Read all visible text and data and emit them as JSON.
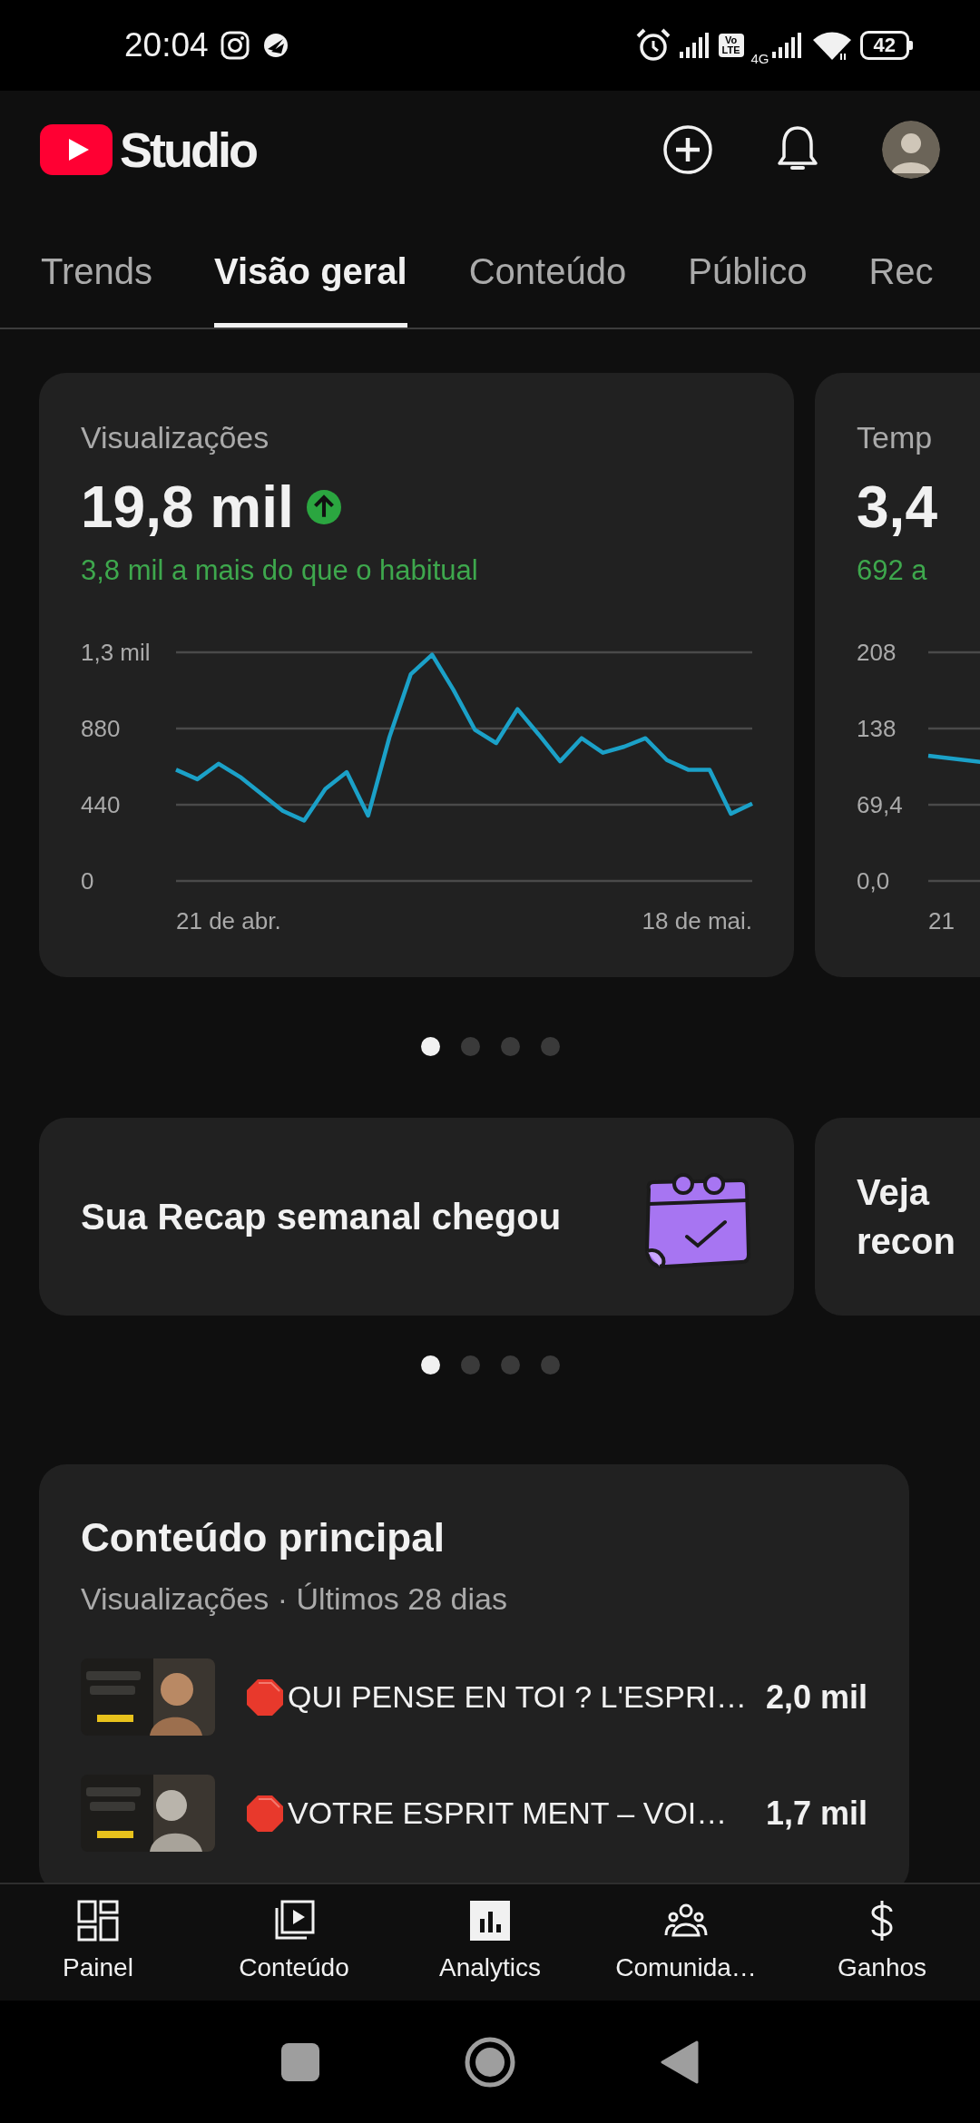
{
  "status_bar": {
    "time": "20:04",
    "volte": "Vo LTE",
    "network": "4G",
    "battery": "42"
  },
  "header": {
    "logo_text": "Studio"
  },
  "tabs": [
    {
      "label": "Trends",
      "selected": false
    },
    {
      "label": "Visão geral",
      "selected": true
    },
    {
      "label": "Conteúdo",
      "selected": false
    },
    {
      "label": "Público",
      "selected": false
    },
    {
      "label": "Rec",
      "selected": false
    }
  ],
  "metric_cards": [
    {
      "title": "Visualizações",
      "value": "19,8 mil",
      "trend_up": true,
      "comparison": "3,8 mil a mais do que o habitual",
      "chart_data": {
        "type": "line",
        "series": [
          {
            "color": "#1ba1c8",
            "values": [
              642,
              587,
              677,
              601,
              503,
              405,
              349,
              531,
              628,
              377,
              831,
              1194,
              1306,
              1103,
              873,
              796,
              992,
              845,
              691,
              824,
              740,
              775,
              824,
              698,
              642,
              642,
              388,
              447
            ]
          }
        ],
        "yticks": [
          880,
          440,
          0
        ],
        "ylim": [
          0,
          1320
        ]
      },
      "y_axis_top_label": "1,3 mil",
      "x_axis_labels": [
        "21 de abr.",
        "18 de mai."
      ]
    },
    {
      "title": "Temp",
      "value": "3,4",
      "comparison": "692 a",
      "y_axis_labels": [
        "208",
        "138",
        "69,4",
        "0,0"
      ],
      "x_label": "21"
    }
  ],
  "metric_dots": [
    {
      "selected": true
    },
    {
      "selected": false
    },
    {
      "selected": false
    },
    {
      "selected": false
    }
  ],
  "recap_cards": [
    {
      "lines": [
        "Sua Recap semanal chegou"
      ],
      "kind": "calendar"
    },
    {
      "lines": [
        "Veja",
        "recon"
      ]
    }
  ],
  "recap_dots": [
    {
      "selected": true
    },
    {
      "selected": false
    },
    {
      "selected": false
    },
    {
      "selected": false
    }
  ],
  "top_content": {
    "title": "Conteúdo principal",
    "subtitle": "Visualizações · Últimos 28 dias",
    "items": [
      {
        "stop_sign": true,
        "title": "QUI PENSE EN TOI ? L'ESPRI…",
        "views": "2,0 mil"
      },
      {
        "stop_sign": true,
        "title": "VOTRE ESPRIT MENT – VOI…",
        "views": "1,7 mil"
      }
    ]
  },
  "bottom_nav": [
    {
      "label": "Painel",
      "selected": false
    },
    {
      "label": "Conteúdo",
      "selected": false
    },
    {
      "label": "Analytics",
      "selected": true
    },
    {
      "label": "Comunida…",
      "selected": false
    },
    {
      "label": "Ganhos",
      "selected": false
    }
  ]
}
